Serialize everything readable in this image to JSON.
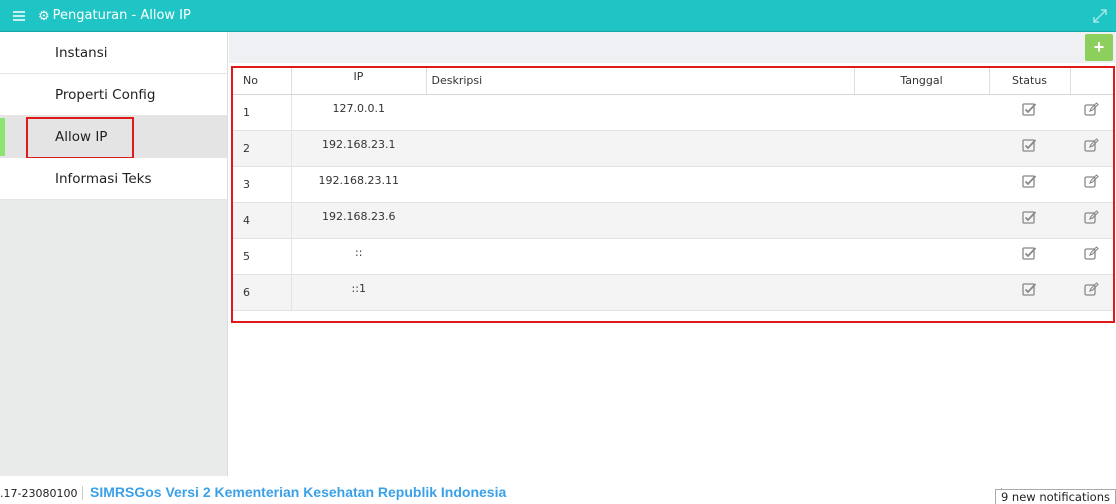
{
  "header": {
    "title": "Pengaturan - Allow IP",
    "menu_icon": "hamburger-icon",
    "gear_icon": "gear-icon",
    "expand_icon": "expand-icon",
    "bg_color": "#1fc4c4"
  },
  "sidebar": {
    "items": [
      {
        "label": "Instansi"
      },
      {
        "label": "Properti Config"
      },
      {
        "label": "Allow IP",
        "active": true
      },
      {
        "label": "Informasi Teks"
      }
    ],
    "active_marker_color": "#8ce36f"
  },
  "toolbar": {
    "add_label": "+",
    "add_color": "#8ccf5c"
  },
  "table": {
    "columns": {
      "no": "No",
      "ip": "IP",
      "desc": "Deskripsi",
      "tanggal": "Tanggal",
      "status": "Status"
    },
    "rows": [
      {
        "no": "1",
        "ip": "127.0.0.1",
        "desc": "",
        "tanggal": ""
      },
      {
        "no": "2",
        "ip": "192.168.23.1",
        "desc": "",
        "tanggal": ""
      },
      {
        "no": "3",
        "ip": "192.168.23.11",
        "desc": "",
        "tanggal": ""
      },
      {
        "no": "4",
        "ip": "192.168.23.6",
        "desc": "",
        "tanggal": ""
      },
      {
        "no": "5",
        "ip": "::",
        "desc": "",
        "tanggal": ""
      },
      {
        "no": "6",
        "ip": "::1",
        "desc": "",
        "tanggal": ""
      }
    ]
  },
  "footer": {
    "version": ".17-23080100",
    "marquee": "SIMRSGos Versi 2 Kementerian Kesehatan Republik Indonesia",
    "notifications": "9 new notifications"
  },
  "highlight_color": "#e01a1a"
}
